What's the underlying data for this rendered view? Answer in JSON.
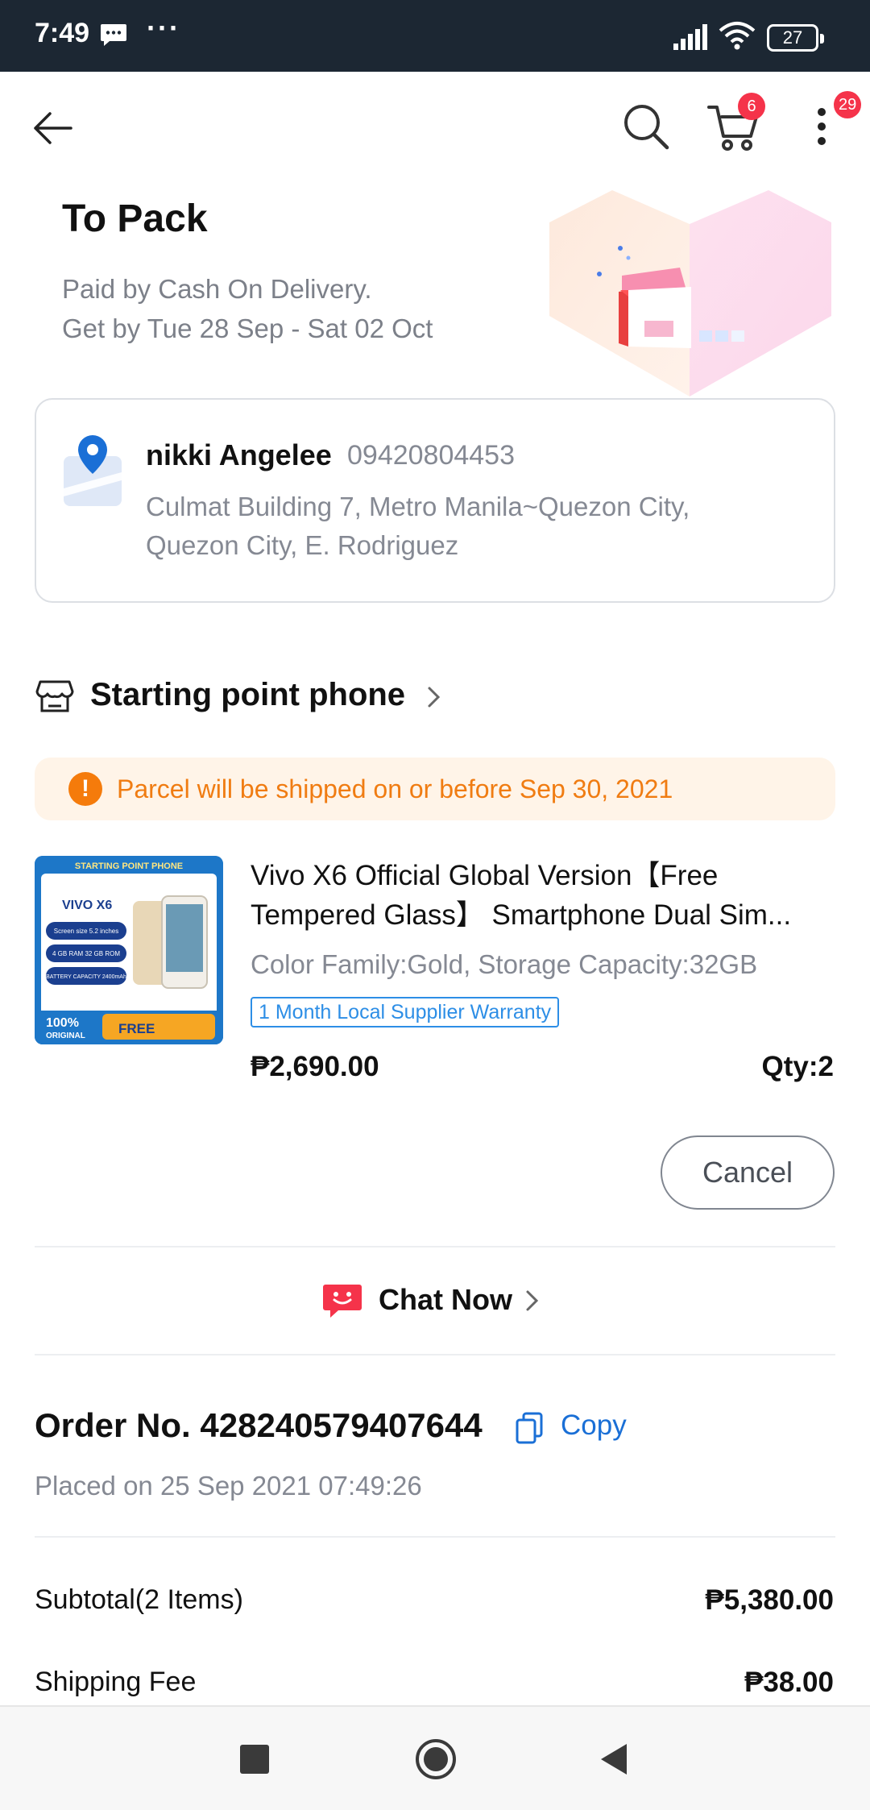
{
  "statusbar": {
    "time": "7:49",
    "dots": "···",
    "battery": "27"
  },
  "nav": {
    "cart_badge": "6",
    "more_badge": "29"
  },
  "order_status": {
    "title": "To Pack",
    "payment": "Paid by Cash On Delivery.",
    "delivery": "Get by Tue 28 Sep - Sat 02 Oct"
  },
  "address": {
    "name": "nikki Angelee",
    "phone": "09420804453",
    "line1": "Culmat Building 7, Metro Manila~Quezon City,",
    "line2": "Quezon City, E. Rodriguez"
  },
  "store": {
    "name": "Starting point phone"
  },
  "notice": {
    "text": "Parcel will be shipped on or before Sep 30, 2021",
    "color": "#f07c12"
  },
  "product": {
    "title_line1": "Vivo X6 Official Global Version【Free",
    "title_line2": "Tempered Glass】 Smartphone Dual Sim...",
    "variant": "Color Family:Gold, Storage Capacity:32GB",
    "tag": "1 Month Local Supplier Warranty",
    "price": "₱2,690.00",
    "qty": "Qty:2",
    "image": {
      "banner": "STARTING POINT PHONE",
      "model": "VIVO X6",
      "spec1": "Screen size 5.2 inches",
      "spec2": "4 GB RAM 32 GB ROM",
      "spec3": "BATTERY CAPACITY 2400mAh",
      "original_pct": "100%",
      "original": "ORIGINAL",
      "free": "FREE"
    }
  },
  "actions": {
    "cancel": "Cancel",
    "chat": "Chat Now"
  },
  "order": {
    "number": "Order No. 428240579407644",
    "copy": "Copy",
    "placed": "Placed on 25 Sep 2021  07:49:26"
  },
  "summary": [
    {
      "label": "Subtotal(2 Items)",
      "value": "₱5,380.00"
    },
    {
      "label": "Shipping Fee",
      "value": "₱38.00"
    }
  ],
  "colors": {
    "accent_blue": "#1a6fd6",
    "badge_red": "#f5334a",
    "notice_bg": "#fff4e8"
  }
}
